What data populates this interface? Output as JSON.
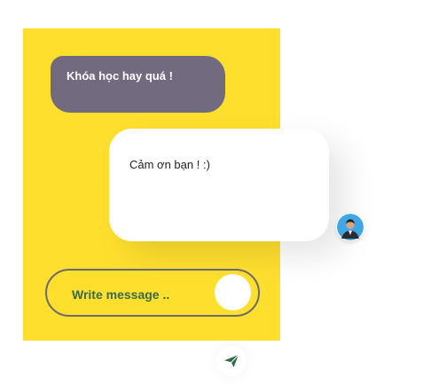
{
  "chat": {
    "sent_message": "Khóa học hay quá !",
    "reply_message": "Cảm ơn bạn ! :)"
  },
  "composer": {
    "placeholder": "Write message .."
  },
  "icons": {
    "avatar": "user-avatar-icon",
    "send": "paper-plane-icon"
  },
  "colors": {
    "panel_background": "#FFDF2E",
    "sent_bubble": "#726A7E",
    "reply_bubble": "#FFFFFF",
    "composer_text": "#356A4C",
    "send_icon": "#2F6B4F",
    "avatar_ring": "#3FA7E6"
  }
}
